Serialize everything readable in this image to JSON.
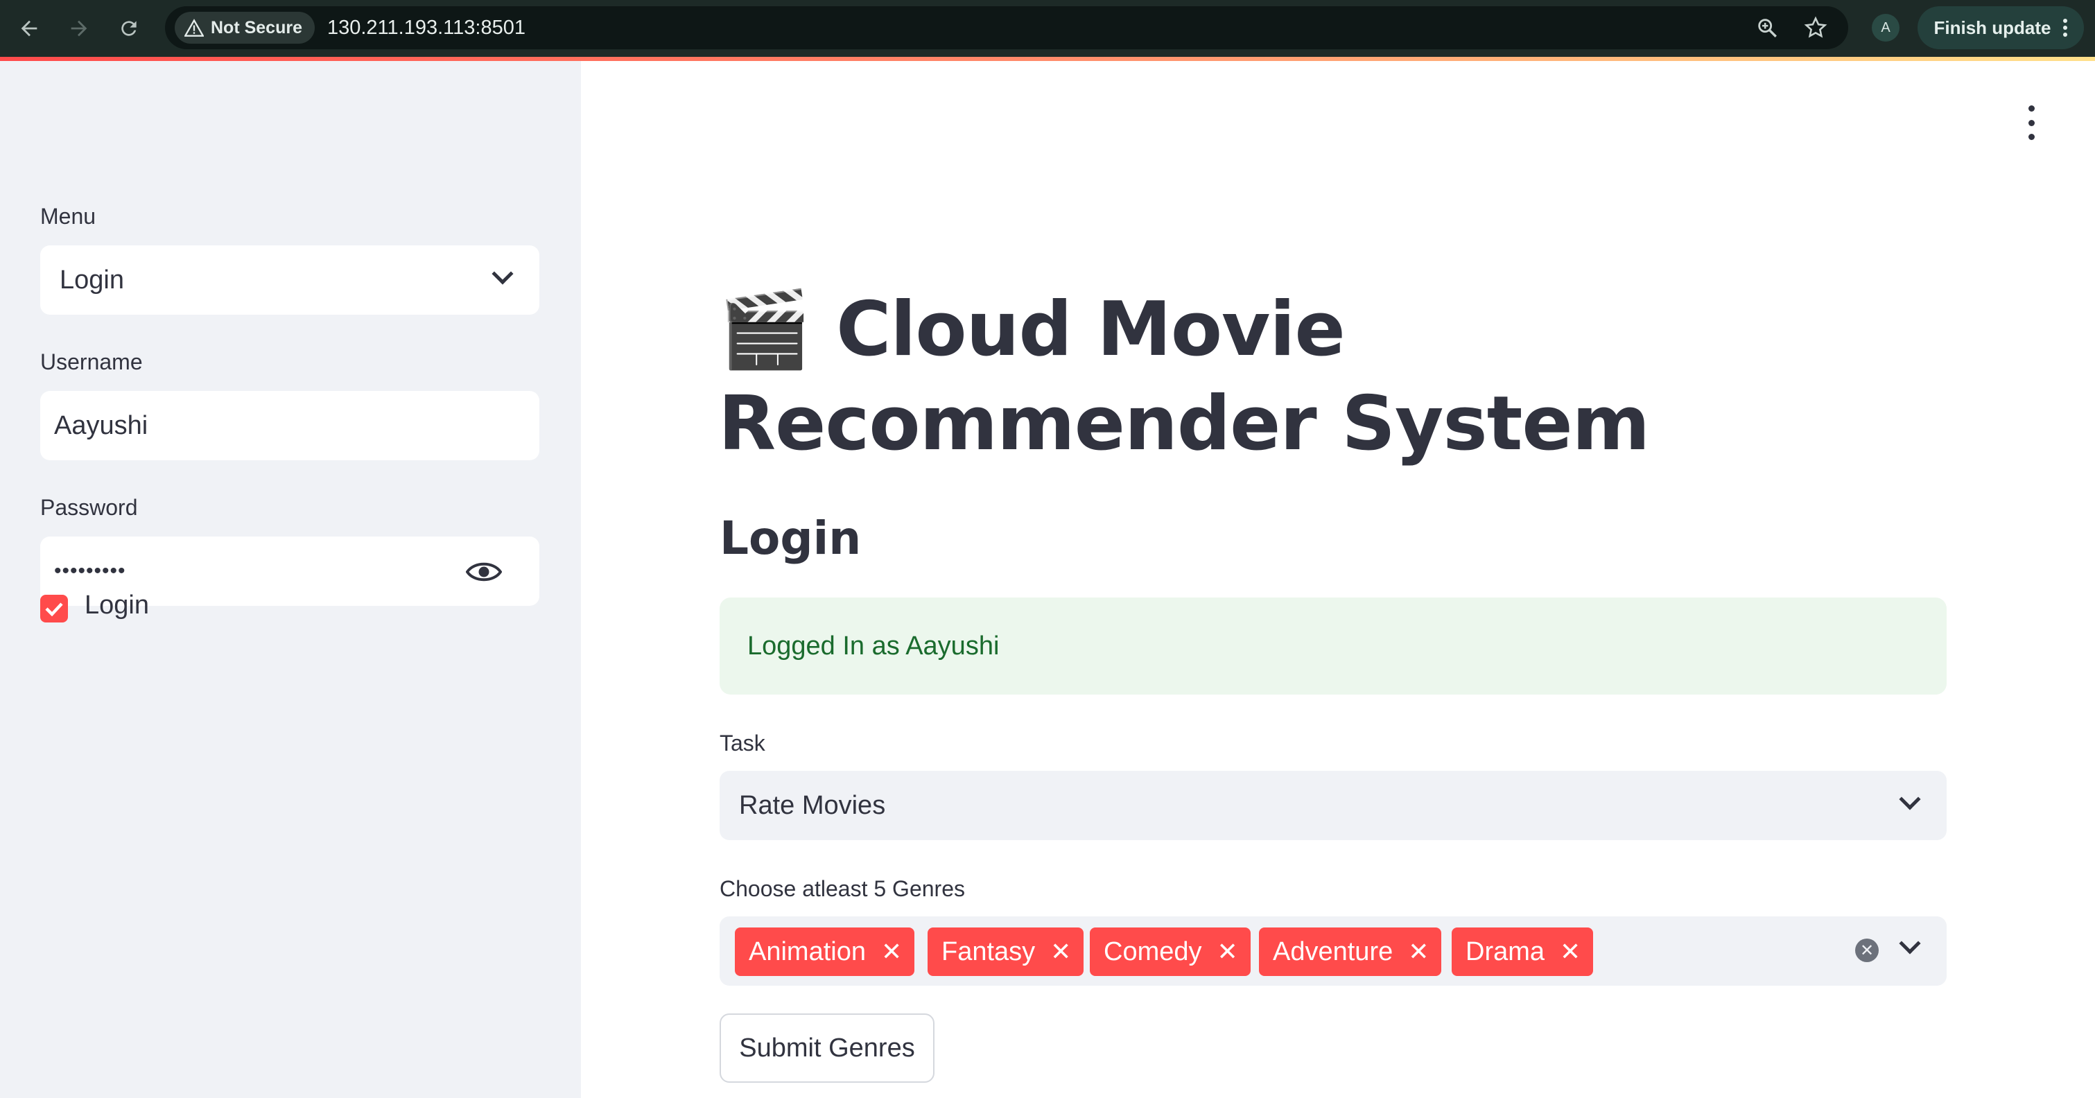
{
  "browser": {
    "back_icon": "arrow-left-icon",
    "forward_icon": "arrow-right-icon",
    "reload_icon": "reload-icon",
    "security_label": "Not Secure",
    "url": "130.211.193.113:8501",
    "avatar_letter": "A",
    "finish_update_label": "Finish update"
  },
  "sidebar": {
    "menu_label": "Menu",
    "menu_value": "Login",
    "username_label": "Username",
    "username_value": "Aayushi",
    "password_label": "Password",
    "password_value": "•••••••••",
    "login_checkbox_label": "Login",
    "login_checked": true
  },
  "main": {
    "title_emoji": "🎬",
    "title": "Cloud Movie Recommender System",
    "section_title": "Login",
    "success_message": "Logged In as Aayushi",
    "task_label": "Task",
    "task_value": "Rate Movies",
    "genres_label": "Choose atleast 5 Genres",
    "genres": [
      "Animation",
      "Fantasy",
      "Comedy",
      "Adventure",
      "Drama"
    ],
    "submit_label": "Submit Genres"
  },
  "colors": {
    "accent": "#ff4b4b",
    "sidebar_bg": "#f0f2f6",
    "text": "#31333f",
    "success_bg": "#ecf7ed",
    "success_text": "#1a6b2d",
    "chrome_bg": "#1d2a27"
  }
}
